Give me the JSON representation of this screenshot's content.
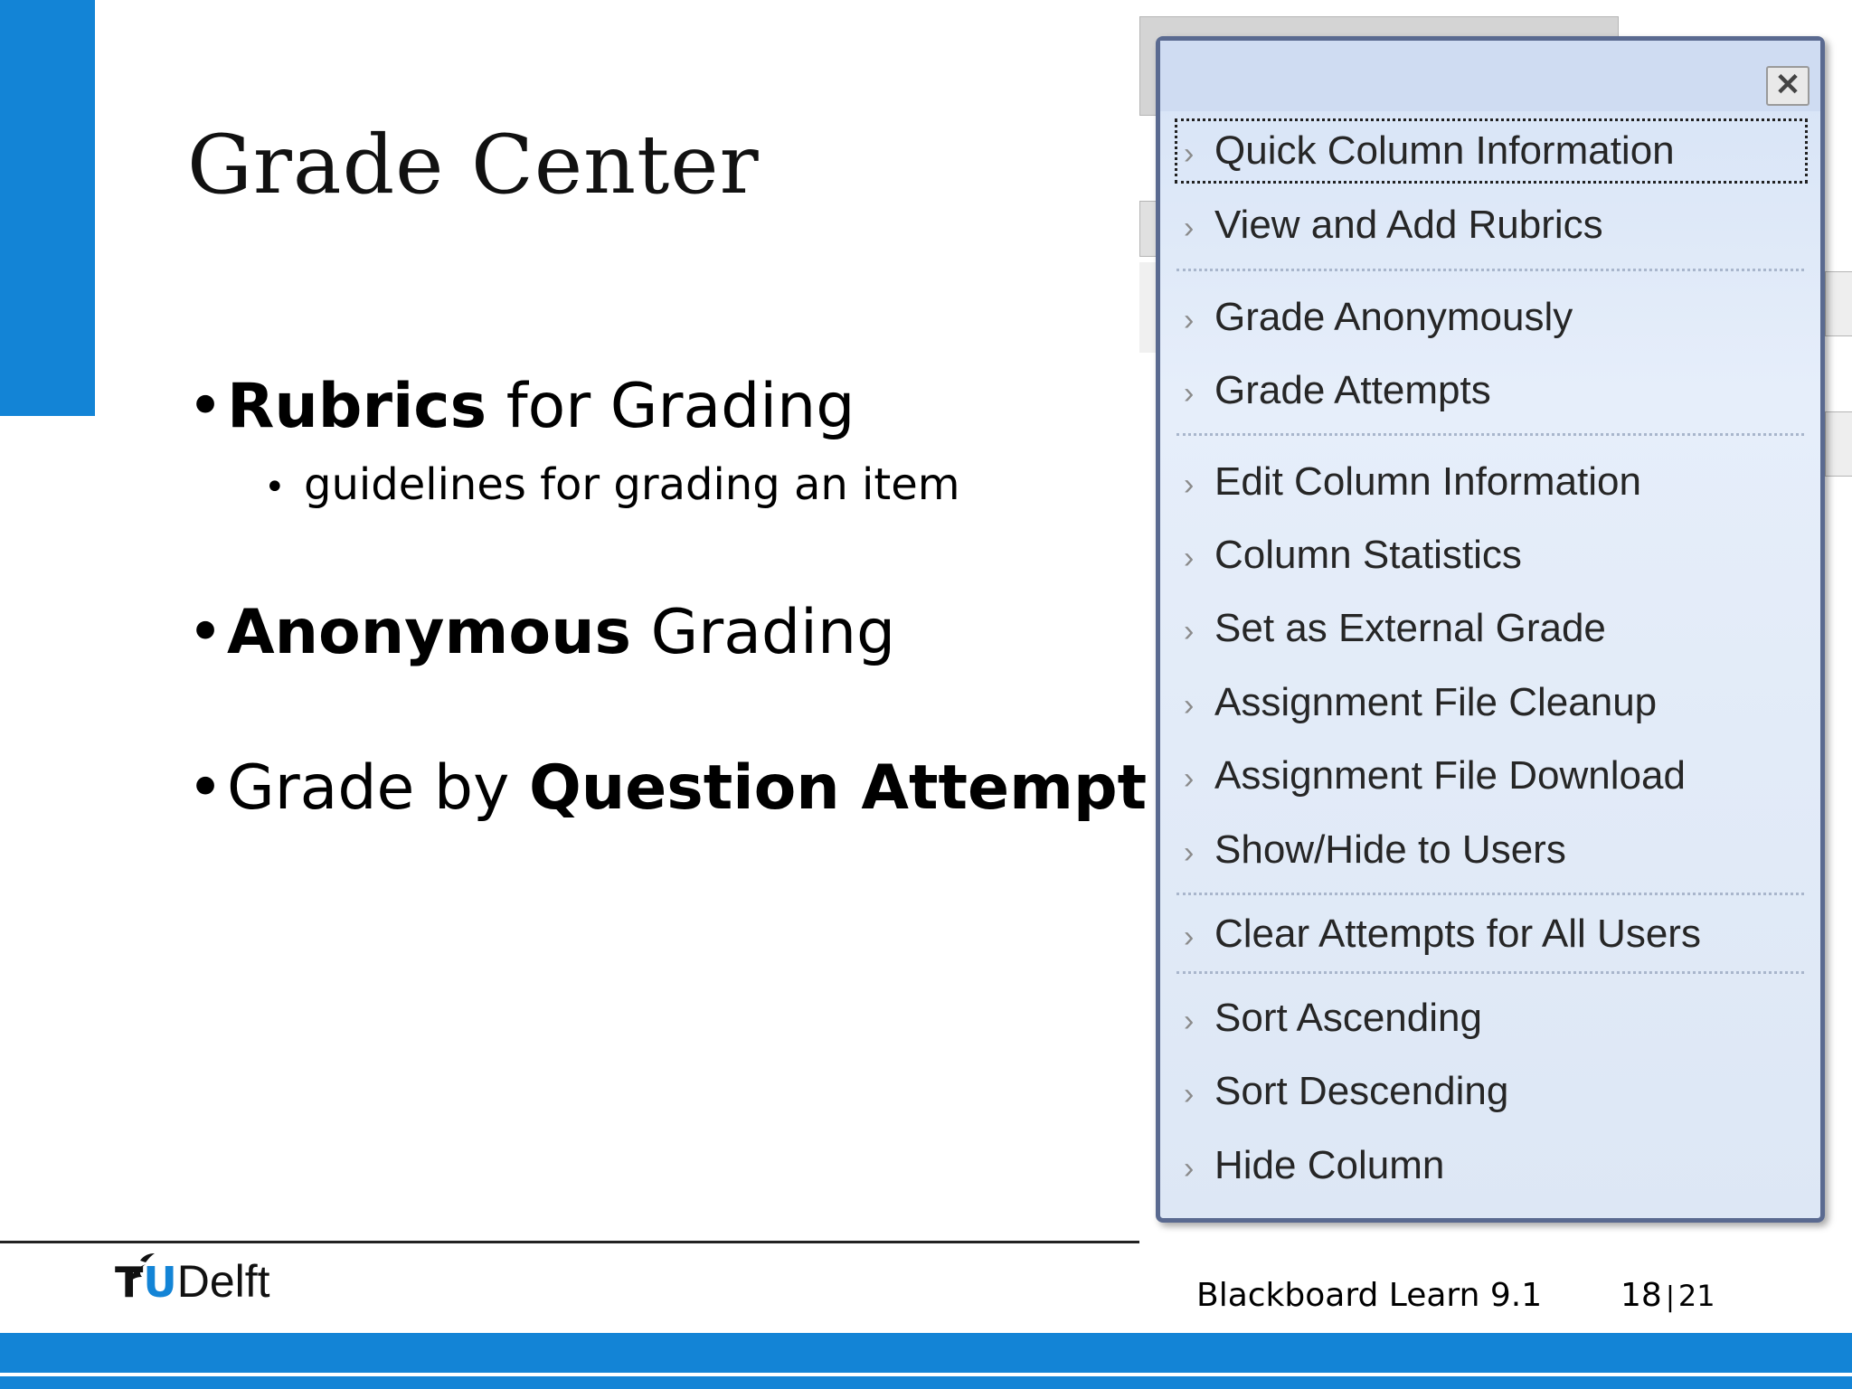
{
  "slide": {
    "title": "Grade Center",
    "bullets": [
      {
        "bold": "Rubrics",
        "rest": " for Grading"
      },
      {
        "bold": "Anonymous",
        "rest": " Grading"
      },
      {
        "pre": "Grade by ",
        "bold": "Question Attempt"
      }
    ],
    "sub_bullet": "guidelines for grading an item"
  },
  "menu": {
    "close_symbol": "✕",
    "items": [
      "Quick Column Information",
      "View and Add Rubrics",
      "Grade Anonymously",
      "Grade Attempts",
      "Edit Column Information",
      "Column Statistics",
      "Set as External Grade",
      "Assignment File Cleanup",
      "Assignment File Download",
      "Show/Hide to Users",
      "Clear Attempts for All Users",
      "Sort Ascending",
      "Sort Descending",
      "Hide Column"
    ]
  },
  "footer": {
    "logo_tu": "T",
    "logo_u": "U",
    "logo_delft": "Delft",
    "course": "Blackboard Learn 9.1",
    "page": "18",
    "separator": "|",
    "total": "21"
  },
  "colors": {
    "accent": "#1384d6",
    "menu_border": "#5a6a90",
    "menu_bg": "#e6eefa"
  },
  "icons": {
    "menu_item": "chevron-right-icon",
    "close": "close-icon"
  }
}
